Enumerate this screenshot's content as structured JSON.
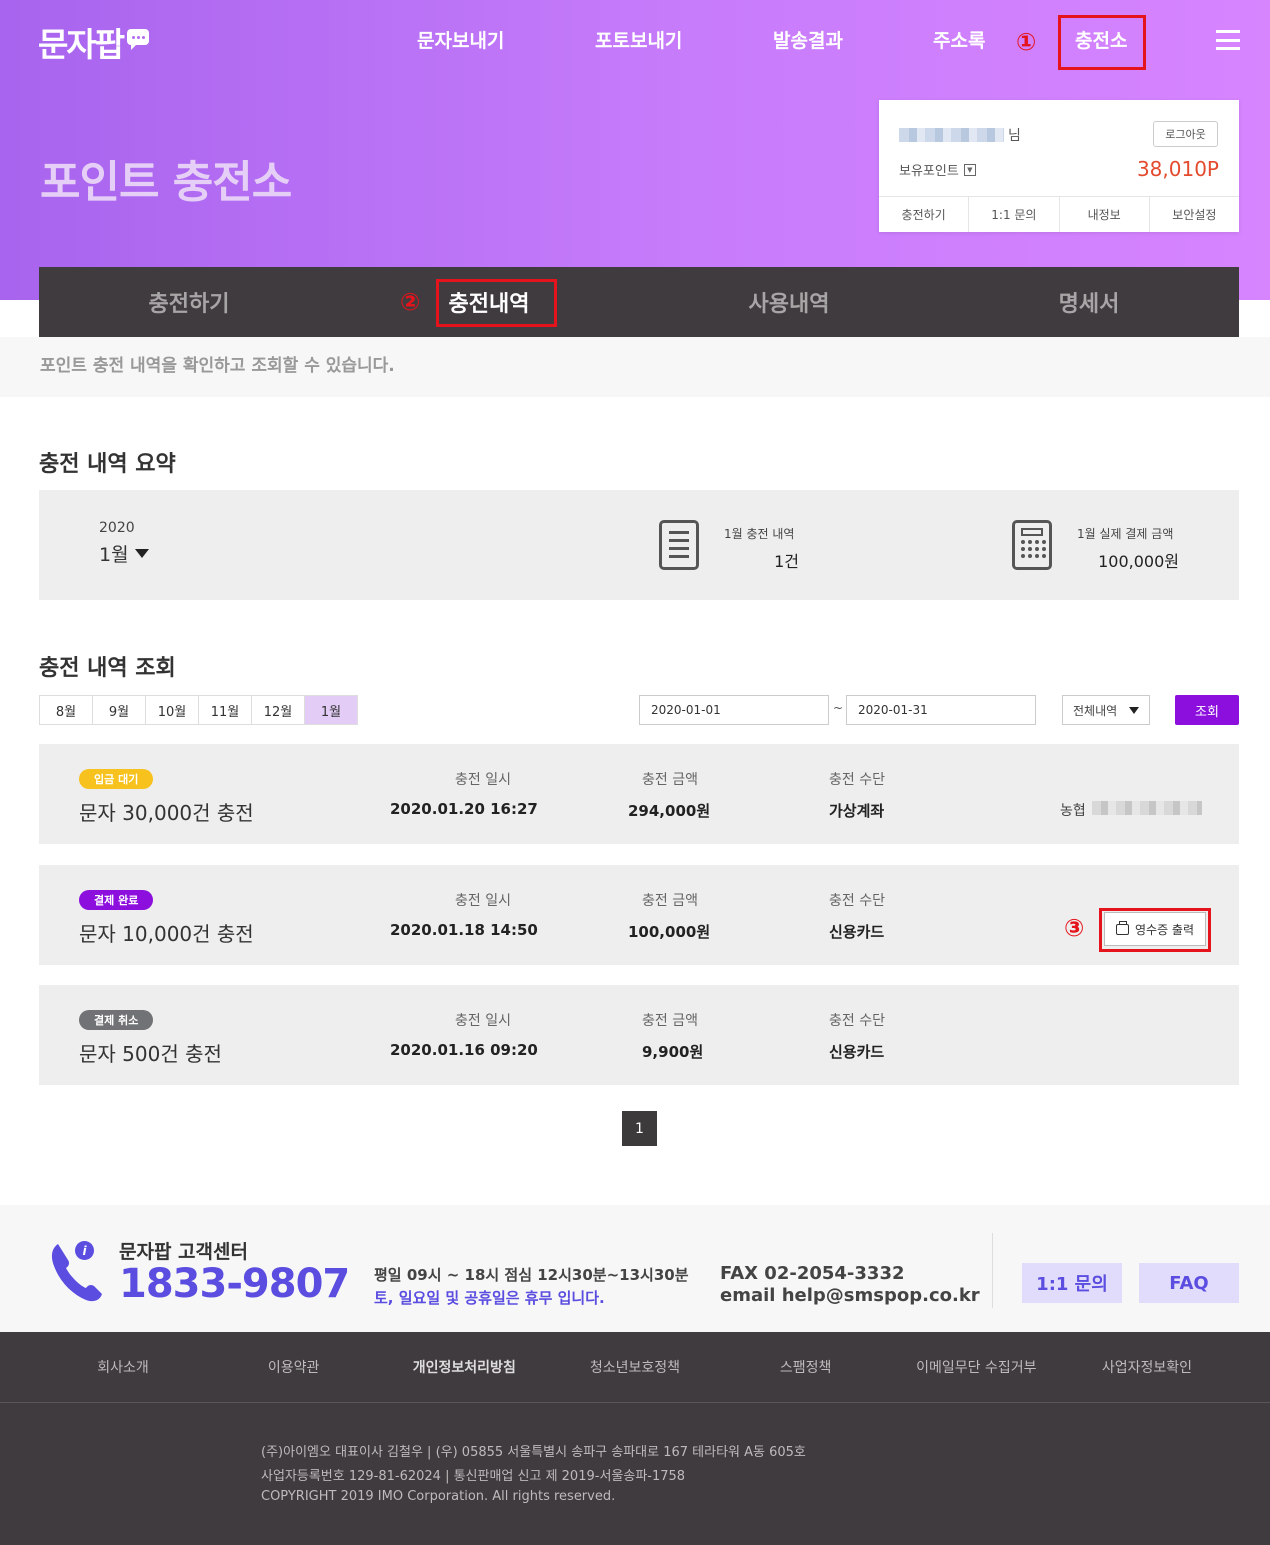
{
  "header": {
    "logo": "문자팝",
    "nav": [
      "문자보내기",
      "포토보내기",
      "발송결과",
      "주소록",
      "충전소"
    ],
    "annotations": [
      "①",
      "②",
      "③"
    ]
  },
  "page_title": "포인트 충전소",
  "account": {
    "nim": "님",
    "logout": "로그아웃",
    "points_label": "보유포인트",
    "points": "38,010P",
    "links": [
      "충전하기",
      "1:1 문의",
      "내정보",
      "보안설정"
    ]
  },
  "tabs": [
    "충전하기",
    "충전내역",
    "사용내역",
    "명세서"
  ],
  "tab_desc": "포인트 충전 내역을 확인하고 조회할 수 있습니다.",
  "summary": {
    "heading": "충전 내역 요약",
    "year": "2020",
    "month": "1월",
    "count_label": "1월 충전 내역",
    "count_value": "1건",
    "amount_label": "1월 실제 결제 금액",
    "amount_value": "100,000원"
  },
  "lookup": {
    "heading": "충전 내역 조회",
    "months": [
      "8월",
      "9월",
      "10월",
      "11월",
      "12월",
      "1월"
    ],
    "start_date": "2020-01-01",
    "tilde": "~",
    "end_date": "2020-01-31",
    "filter": "전체내역",
    "search_button": "조회"
  },
  "records": [
    {
      "status": "입금 대기",
      "status_color": "#f7c21d",
      "title": "문자 30,000건 충전",
      "date_label": "충전 일시",
      "date": "2020.01.20 16:27",
      "amount_label": "충전 금액",
      "amount": "294,000원",
      "method_label": "충전 수단",
      "method": "가상계좌",
      "bank": "농협"
    },
    {
      "status": "결제 완료",
      "status_color": "#8c0fde",
      "title": "문자 10,000건 충전",
      "date_label": "충전 일시",
      "date": "2020.01.18 14:50",
      "amount_label": "충전 금액",
      "amount": "100,000원",
      "method_label": "충전 수단",
      "method": "신용카드",
      "receipt": "영수증 출력"
    },
    {
      "status": "결제 취소",
      "status_color": "#707275",
      "title": "문자 500건 충전",
      "date_label": "충전 일시",
      "date": "2020.01.16 09:20",
      "amount_label": "충전 금액",
      "amount": "9,900원",
      "method_label": "충전 수단",
      "method": "신용카드"
    }
  ],
  "pagination": {
    "current": "1"
  },
  "customer_center": {
    "title": "문자팝 고객센터",
    "phone": "1833-9807",
    "hours": "평일 09시 ~ 18시 점심 12시30분~13시30분",
    "holiday": "토, 일요일 및 공휴일은 휴무 입니다.",
    "fax": "FAX 02-2054-3332",
    "email": "email help@smspop.co.kr",
    "inquiry_button": "1:1 문의",
    "faq_button": "FAQ"
  },
  "footer": {
    "links": [
      "회사소개",
      "이용약관",
      "개인정보처리방침",
      "청소년보호정책",
      "스팸정책",
      "이메일무단 수집거부",
      "사업자정보확인"
    ],
    "address": "(주)아이엠오 대표이사 김철우 | (우) 05855 서울특별시 송파구 송파대로 167 테라타워 A동 605호",
    "registration": "사업자등록번호 129-81-62024 | 통신판매업 신고 제 2019-서울송파-1758",
    "copyright": "COPYRIGHT 2019 IMO Corporation. All rights reserved."
  }
}
